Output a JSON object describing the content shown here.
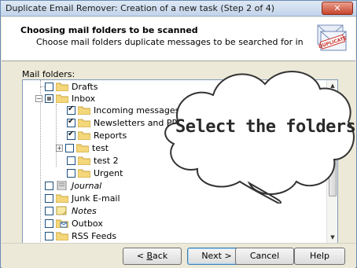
{
  "window": {
    "title": "Duplicate Email Remover: Creation of a new task (Step 2 of 4)",
    "close_glyph": "✕"
  },
  "header": {
    "title": "Choosing mail folders to be scanned",
    "subtitle": "Choose mail folders duplicate messages to be searched for in",
    "icon_badge": "DUPLICATE"
  },
  "folders": {
    "label": "Mail folders:",
    "items": [
      {
        "label": "Drafts",
        "checked": false,
        "italic": false
      },
      {
        "label": "Inbox",
        "checked": "partial",
        "italic": false,
        "expanded": true
      },
      {
        "label": "Incoming messages",
        "checked": true,
        "italic": false
      },
      {
        "label": "Newsletters and PR",
        "checked": true,
        "italic": false
      },
      {
        "label": "Reports",
        "checked": true,
        "italic": false
      },
      {
        "label": "test",
        "checked": false,
        "italic": false,
        "collapsed": true
      },
      {
        "label": "test 2",
        "checked": false,
        "italic": false
      },
      {
        "label": "Urgent",
        "checked": false,
        "italic": false
      },
      {
        "label": "Journal",
        "checked": false,
        "italic": true
      },
      {
        "label": "Junk E-mail",
        "checked": false,
        "italic": false
      },
      {
        "label": "Notes",
        "checked": false,
        "italic": true
      },
      {
        "label": "Outbox",
        "checked": false,
        "italic": false
      },
      {
        "label": "RSS Feeds",
        "checked": false,
        "italic": false
      }
    ]
  },
  "callout": {
    "text": "Select the folders!"
  },
  "buttons": {
    "back_prefix": "< ",
    "back_key": "B",
    "back_rest": "ack",
    "next_label": "Next >",
    "cancel_label": "Cancel",
    "help_label": "Help"
  },
  "colors": {
    "folder_yellow": "#f4d77a",
    "callout_fill": "#ffffff",
    "accent_blue": "#3c7fb1"
  }
}
